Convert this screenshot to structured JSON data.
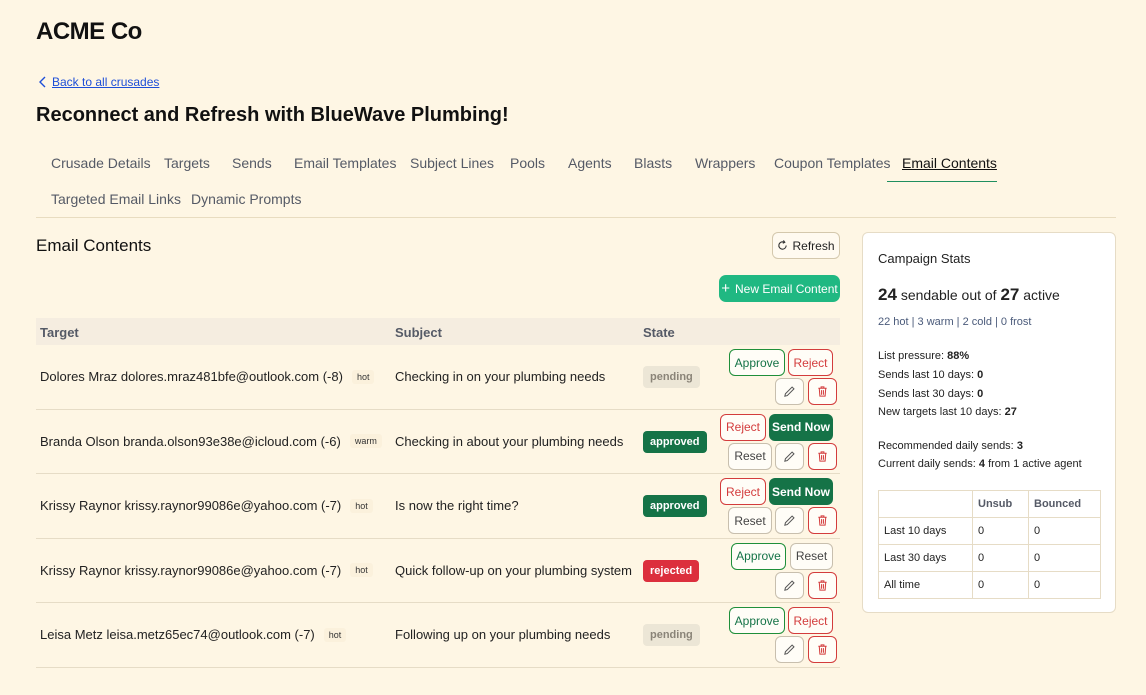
{
  "brand": "ACME Co",
  "back_link": "Back to all crusades",
  "page_title": "Reconnect and Refresh with BlueWave Plumbing!",
  "tabs": [
    "Crusade Details",
    "Targets",
    "Sends",
    "Email Templates",
    "Subject Lines",
    "Pools",
    "Agents",
    "Blasts",
    "Wrappers",
    "Coupon Templates",
    "Email Contents",
    "Targeted Email Links",
    "Dynamic Prompts"
  ],
  "active_tab": "Email Contents",
  "section_title": "Email Contents",
  "refresh_label": "Refresh",
  "new_label": "New Email Content",
  "columns": {
    "target": "Target",
    "subject": "Subject",
    "state": "State"
  },
  "action_labels": {
    "approve": "Approve",
    "reject": "Reject",
    "send_now": "Send Now",
    "reset": "Reset"
  },
  "icons": {
    "back": "chevron-left-icon",
    "refresh": "refresh-icon",
    "new": "plus-icon",
    "edit": "pencil-icon",
    "delete": "trash-icon"
  },
  "colors": {
    "background": "#fef6e4",
    "primary": "#20b882",
    "approved": "#157347",
    "rejected": "#dc2f3d",
    "link": "#1d4ed8"
  },
  "rows": [
    {
      "target": "Dolores Mraz dolores.mraz481bfe@outlook.com (-8)",
      "tag": "hot",
      "subject": "Checking in on your plumbing needs",
      "state": "pending"
    },
    {
      "target": "Branda Olson branda.olson93e38e@icloud.com (-6)",
      "tag": "warm",
      "subject": "Checking in about your plumbing needs",
      "state": "approved"
    },
    {
      "target": "Krissy Raynor krissy.raynor99086e@yahoo.com (-7)",
      "tag": "hot",
      "subject": "Is now the right time?",
      "state": "approved"
    },
    {
      "target": "Krissy Raynor krissy.raynor99086e@yahoo.com (-7)",
      "tag": "hot",
      "subject": "Quick follow-up on your plumbing system",
      "state": "rejected"
    },
    {
      "target": "Leisa Metz leisa.metz65ec74@outlook.com (-7)",
      "tag": "hot",
      "subject": "Following up on your plumbing needs",
      "state": "pending"
    }
  ],
  "stats": {
    "title": "Campaign Stats",
    "sendable": "24",
    "sendable_mid": "sendable out of",
    "active": "27",
    "active_suffix": "active",
    "tiers": "22 hot | 3 warm | 2 cold | 0 frost",
    "list_pressure_label": "List pressure:",
    "list_pressure": "88%",
    "sends_10_label": "Sends last 10 days:",
    "sends_10": "0",
    "sends_30_label": "Sends last 30 days:",
    "sends_30": "0",
    "new_targets_label": "New targets last 10 days:",
    "new_targets": "27",
    "recommended_label": "Recommended daily sends:",
    "recommended": "3",
    "current_label": "Current daily sends:",
    "current": "4",
    "current_suffix": "from 1 active agent",
    "table_headers": [
      "",
      "Unsub",
      "Bounced"
    ],
    "table_rows": [
      [
        "Last 10 days",
        "0",
        "0"
      ],
      [
        "Last 30 days",
        "0",
        "0"
      ],
      [
        "All time",
        "0",
        "0"
      ]
    ]
  }
}
